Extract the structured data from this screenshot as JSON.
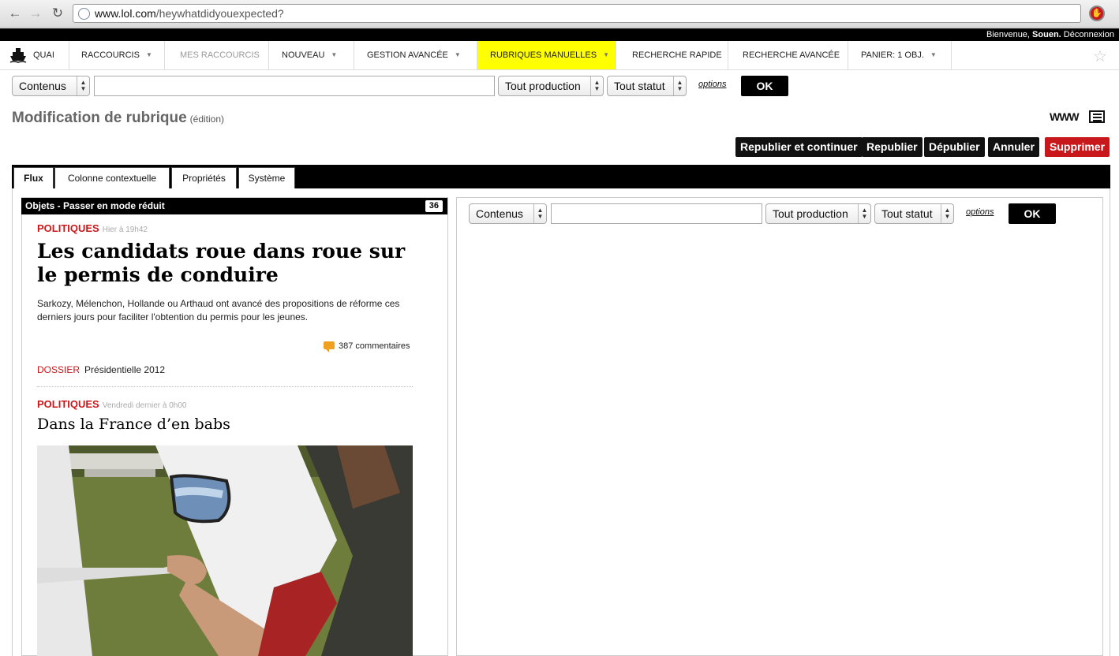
{
  "browser": {
    "url_domain": "www.lol.com",
    "url_path": "/heywhatdidyouexpected?"
  },
  "welcome": {
    "prefix": "Bienvenue, ",
    "user": "Souen.",
    "logout": " Déconnexion"
  },
  "menu": {
    "quai": "QUAI",
    "raccourcis": "RACCOURCIS",
    "mes_raccourcis": "MES RACCOURCIS",
    "nouveau": "NOUVEAU",
    "gestion": "GESTION AVANCÉE",
    "rubriques": "RUBRIQUES MANUELLES",
    "recherche_rapide": "RECHERCHE RAPIDE",
    "recherche_avancee": "RECHERCHE AVANCÉE",
    "panier": "PANIER: 1 OBJ."
  },
  "search": {
    "type_select": "Contenus",
    "production_select": "Tout production",
    "status_select": "Tout statut",
    "options": "options",
    "ok": "OK"
  },
  "page": {
    "title": "Modification de rubrique",
    "subtitle": "(édition)",
    "www_icon_label": "WWW"
  },
  "actions": {
    "republish_continue": "Republier et continuer",
    "republish": "Republier",
    "unpublish": "Dépublier",
    "cancel": "Annuler",
    "delete": "Supprimer"
  },
  "tabs": [
    "Flux",
    "Colonne contextuelle",
    "Propriétés",
    "Système"
  ],
  "left_panel": {
    "header": "Objets - Passer en mode réduit",
    "count": "36",
    "articles": [
      {
        "category": "POLITIQUES",
        "time": "Hier à 19h42",
        "headline": "Les candidats roue dans roue sur le permis de conduire",
        "summary": "Sarkozy, Mélenchon, Hollande ou Arthaud ont avancé des propositions de réforme ces derniers jours pour faciliter l'obtention du permis pour les jeunes.",
        "comments": "387 commentaires",
        "dossier_label": "DOSSIER",
        "dossier_name": "Présidentielle 2012"
      },
      {
        "category": "POLITIQUES",
        "time": "Vendredi dernier à 0h00",
        "headline": "Dans la France d’en babs"
      }
    ]
  },
  "colors": {
    "accent_red": "#c8181c",
    "highlight_yellow": "#ffff00",
    "dark": "#000000"
  }
}
